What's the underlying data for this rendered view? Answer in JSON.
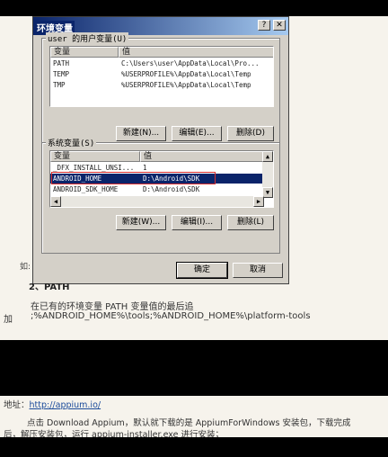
{
  "dialog": {
    "title": "环境变量",
    "help_btn": "?",
    "close_btn": "✕",
    "user_vars": {
      "group_label": "user 的用户变量(U)",
      "col_var": "变量",
      "col_val": "值",
      "rows": [
        {
          "name": "PATH",
          "value": "C:\\Users\\user\\AppData\\Local\\Pro..."
        },
        {
          "name": "TEMP",
          "value": "%USERPROFILE%\\AppData\\Local\\Temp"
        },
        {
          "name": "TMP",
          "value": "%USERPROFILE%\\AppData\\Local\\Temp"
        }
      ],
      "new_btn": "新建(N)...",
      "edit_btn": "编辑(E)...",
      "delete_btn": "删除(D)"
    },
    "sys_vars": {
      "group_label": "系统变量(S)",
      "col_var": "变量",
      "col_val": "值",
      "rows": [
        {
          "name": "_DFX_INSTALL_UNSI...",
          "value": "1"
        },
        {
          "name": "ANDROID_HOME",
          "value": "D:\\Android\\SDK"
        },
        {
          "name": "ANDROID_SDK_HOME",
          "value": "D:\\Android\\SDK"
        }
      ],
      "new_btn": "新建(W)...",
      "edit_btn": "编辑(I)...",
      "delete_btn": "删除(L)"
    },
    "ok_btn": "确定",
    "cancel_btn": "取消"
  },
  "caption_prefix": "如:",
  "section_heading": "2、PATH",
  "para1": "在已有的环境变量 PATH 变量值的最后追",
  "para2_prefix": "加",
  "para2": ";%ANDROID_HOME%\\tools;%ANDROID_HOME%\\platform-tools",
  "address_label": "地址：",
  "address_link": "http://appium.io/",
  "para3": "点击 Download Appium，默认就下载的是 AppiumForWindows 安装包，下载完成",
  "para4": "后，解压安装包，运行 appium-installer.exe 进行安装；"
}
